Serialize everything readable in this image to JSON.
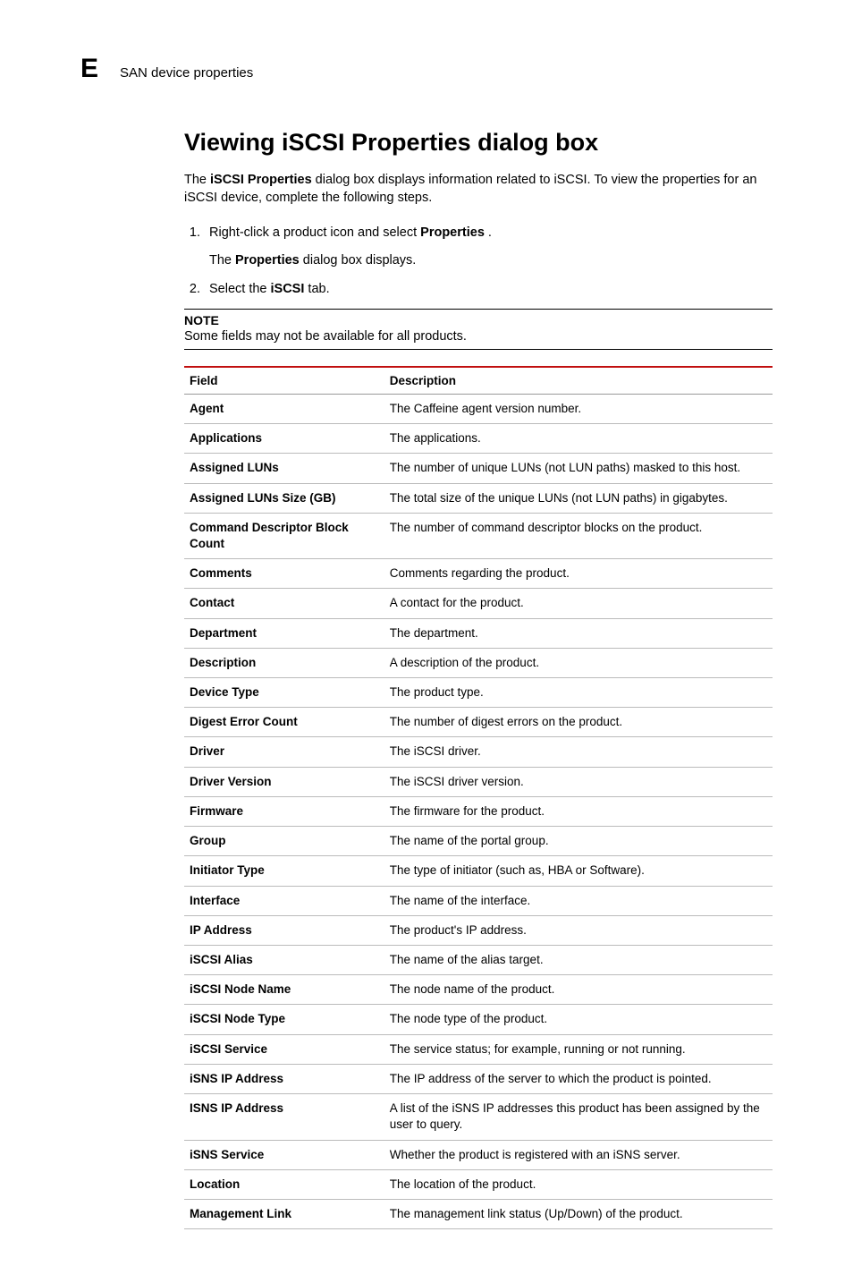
{
  "header": {
    "letter": "E",
    "title": "SAN device properties"
  },
  "section": {
    "title": "Viewing iSCSI Properties dialog box",
    "intro_pre": "The ",
    "intro_bold1": "iSCSI Properties",
    "intro_post": " dialog box displays information related to iSCSI. To view the properties for an iSCSI device, complete the following steps.",
    "step1_pre": "Right-click a product icon and select ",
    "step1_bold": "Properties",
    "step1_post": " .",
    "step1_sub_pre": "The ",
    "step1_sub_bold": "Properties",
    "step1_sub_post": " dialog box displays.",
    "step2_pre": "Select the ",
    "step2_bold": "iSCSI",
    "step2_post": " tab.",
    "note_label": "NOTE",
    "note_text": "Some fields may not be available for all products."
  },
  "table": {
    "header_field": "Field",
    "header_desc": "Description",
    "rows": [
      {
        "field": "Agent",
        "desc": "The Caffeine agent version number."
      },
      {
        "field": "Applications",
        "desc": "The applications."
      },
      {
        "field": "Assigned LUNs",
        "desc": "The number of unique LUNs (not LUN paths) masked to this host."
      },
      {
        "field": "Assigned LUNs Size (GB)",
        "desc": "The total size of the unique LUNs (not LUN paths) in gigabytes."
      },
      {
        "field": "Command Descriptor Block Count",
        "desc": "The number of command descriptor blocks on the product."
      },
      {
        "field": "Comments",
        "desc": "Comments regarding the product."
      },
      {
        "field": "Contact",
        "desc": "A contact for the product."
      },
      {
        "field": "Department",
        "desc": "The department."
      },
      {
        "field": "Description",
        "desc": "A description of the product."
      },
      {
        "field": "Device Type",
        "desc": "The product type."
      },
      {
        "field": "Digest Error Count",
        "desc": "The number of digest errors on the product."
      },
      {
        "field": "Driver",
        "desc": "The iSCSI driver."
      },
      {
        "field": "Driver Version",
        "desc": "The iSCSI driver version."
      },
      {
        "field": "Firmware",
        "desc": "The firmware for the product."
      },
      {
        "field": "Group",
        "desc": "The name of the portal group."
      },
      {
        "field": "Initiator Type",
        "desc": "The type of initiator (such as, HBA or Software)."
      },
      {
        "field": "Interface",
        "desc": "The name of the interface."
      },
      {
        "field": "IP Address",
        "desc": "The product's IP address."
      },
      {
        "field": "iSCSI Alias",
        "desc": "The name of the alias target."
      },
      {
        "field": "iSCSI Node Name",
        "desc": "The node name of the product."
      },
      {
        "field": "iSCSI Node Type",
        "desc": "The node type of the product."
      },
      {
        "field": "iSCSI Service",
        "desc": "The service status; for example, running or not running."
      },
      {
        "field": "iSNS IP Address",
        "desc": "The IP address of the server to which the product is pointed."
      },
      {
        "field": "ISNS IP Address",
        "desc": "A list of the iSNS IP addresses this product has been assigned by the user to query."
      },
      {
        "field": "iSNS Service",
        "desc": "Whether the product is registered with an iSNS server."
      },
      {
        "field": "Location",
        "desc": "The location of the product."
      },
      {
        "field": "Management Link",
        "desc": "The management link status (Up/Down) of the product."
      }
    ]
  }
}
